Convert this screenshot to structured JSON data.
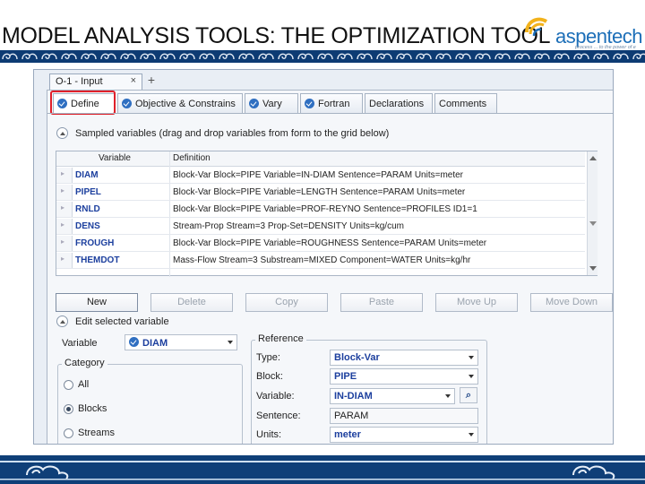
{
  "slide": {
    "title": "MODEL ANALYSIS TOOLS: THE OPTIMIZATION TOOL",
    "logo_text": "aspentech",
    "logo_tagline": "process ... to the power of e"
  },
  "colors": {
    "band": "#0d3b73",
    "highlight": "#e0202a",
    "variable_text": "#1c3f9e"
  },
  "window": {
    "doc_tab": "O-1 - Input",
    "doc_tab_close": "×",
    "new_tab": "+"
  },
  "tabs": [
    {
      "label": "Define",
      "active": true
    },
    {
      "label": "Objective & Constrains"
    },
    {
      "label": "Vary"
    },
    {
      "label": "Fortran"
    },
    {
      "label": "Declarations"
    },
    {
      "label": "Comments"
    }
  ],
  "sampled": {
    "heading": "Sampled variables (drag and drop variables from form to the grid below)",
    "columns": [
      "Variable",
      "Definition"
    ],
    "rows": [
      {
        "variable": "DIAM",
        "definition": "Block-Var Block=PIPE Variable=IN-DIAM Sentence=PARAM Units=meter"
      },
      {
        "variable": "PIPEL",
        "definition": "Block-Var Block=PIPE Variable=LENGTH Sentence=PARAM Units=meter"
      },
      {
        "variable": "RNLD",
        "definition": "Block-Var Block=PIPE Variable=PROF-REYNO Sentence=PROFILES ID1=1"
      },
      {
        "variable": "DENS",
        "definition": "Stream-Prop Stream=3 Prop-Set=DENSITY Units=kg/cum"
      },
      {
        "variable": "FROUGH",
        "definition": "Block-Var Block=PIPE Variable=ROUGHNESS Sentence=PARAM Units=meter"
      },
      {
        "variable": "THEMDOT",
        "definition": "Mass-Flow Stream=3 Substream=MIXED Component=WATER Units=kg/hr"
      }
    ]
  },
  "buttons": [
    {
      "label": "New",
      "enabled": true
    },
    {
      "label": "Delete"
    },
    {
      "label": "Copy"
    },
    {
      "label": "Paste"
    },
    {
      "label": "Move Up"
    },
    {
      "label": "Move Down"
    }
  ],
  "edit": {
    "heading": "Edit selected variable",
    "variable_label": "Variable",
    "variable_value": "DIAM",
    "category_legend": "Category",
    "category_options": [
      {
        "label": "All",
        "selected": false
      },
      {
        "label": "Blocks",
        "selected": true
      },
      {
        "label": "Streams",
        "selected": false
      }
    ],
    "reference_legend": "Reference",
    "reference_fields": [
      {
        "label": "Type:",
        "value": "Block-Var"
      },
      {
        "label": "Block:",
        "value": "PIPE"
      },
      {
        "label": "Variable:",
        "value": "IN-DIAM"
      },
      {
        "label": "Sentence:",
        "value": "PARAM"
      },
      {
        "label": "Units:",
        "value": "meter"
      }
    ]
  }
}
